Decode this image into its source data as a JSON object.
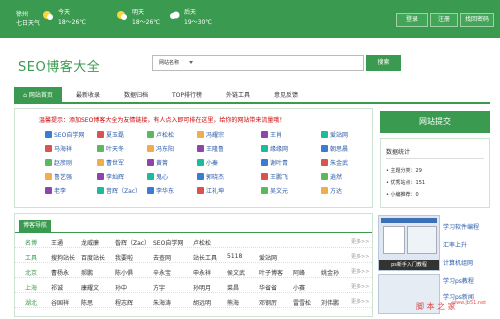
{
  "topbar": {
    "city_name": "徐州",
    "city_sub": "七日天气",
    "days": [
      {
        "label": "今天",
        "temp": "18～26℃"
      },
      {
        "label": "明天",
        "temp": "18～26℃"
      },
      {
        "label": "后天",
        "temp": "19～30℃"
      }
    ],
    "login": "登录",
    "register": "注册",
    "homepage": "找回密码"
  },
  "header": {
    "logo": "SEO博客大全",
    "search_label": "网站名称",
    "search_button": "搜索"
  },
  "nav": {
    "items": [
      "网站首页",
      "最新收录",
      "数据归档",
      "TOP排行榜",
      "外链工具",
      "意见反馈"
    ]
  },
  "notice": {
    "message": "温馨提示：添加SEO博客大全为友情链接，有人点入即可排在这里，给你的网站带来流量哦！",
    "sites": [
      [
        "SEO自学网",
        "夏玉磊",
        "卢松松",
        "冯耀宗",
        "王肖",
        "爱站网"
      ],
      [
        "马海祥",
        "叶天冬",
        "冯东阳",
        "王隆鲁",
        "缘缘网",
        "朝思晨"
      ],
      [
        "赵彦刚",
        "曹世军",
        "黄箐",
        "小秦",
        "谢叶青",
        "朱金武"
      ],
      [
        "鲁艺强",
        "李灿辉",
        "鬼心",
        "郭晓杰",
        "王鹏飞",
        "逍然"
      ],
      [
        "老李",
        "昔辉（Zac）",
        "李华东",
        "江礼坤",
        "吴文元",
        "方达"
      ]
    ]
  },
  "blognav": {
    "title": "博客导航",
    "more": "更多>>",
    "rows": [
      {
        "cat": "名博",
        "items": [
          "王通",
          "龙威廉",
          "昝辉（Zac）",
          "SEO自学网",
          "卢松松"
        ]
      },
      {
        "cat": "工具",
        "items": [
          "搜狗站长",
          "百度站长",
          "我要啦",
          "去查网",
          "站长工具",
          "5118",
          "爱站网"
        ]
      },
      {
        "cat": "北京",
        "items": [
          "曹杨永",
          "郝鹏",
          "陈小俱",
          "辛永宝",
          "申永祥",
          "侯文武",
          "叶子博客",
          "阿峰",
          "姚金孙"
        ]
      },
      {
        "cat": "上海",
        "items": [
          "祁诚",
          "康耀文",
          "孙中",
          "方宇",
          "孙明月",
          "菜昌",
          "华省省",
          "小赛"
        ]
      },
      {
        "cat": "湖北",
        "items": [
          "谷国祥",
          "陈思",
          "程志辉",
          "朱海涛",
          "胡远明",
          "熊海",
          "邓钢厉",
          "雷雪松",
          "刘伟鹏"
        ]
      }
    ]
  },
  "sidebar": {
    "title": "网站提交",
    "stats_title": "数据统计",
    "stats": [
      "主题分类：29",
      "优秀站点：151",
      "小编推荐：0"
    ],
    "shot_caption": "ps新手入门教程",
    "links": [
      "学习软件编程",
      "汇率上升",
      "计算机组网",
      "学习ps教程",
      "学习ps新闻"
    ]
  },
  "watermark": {
    "text": "脚 本 之 家",
    "url": "www.jb51.net"
  },
  "colors": {
    "primary": "#3a9a4f",
    "link": "#2a5aa8",
    "notice": "#cc0000"
  }
}
